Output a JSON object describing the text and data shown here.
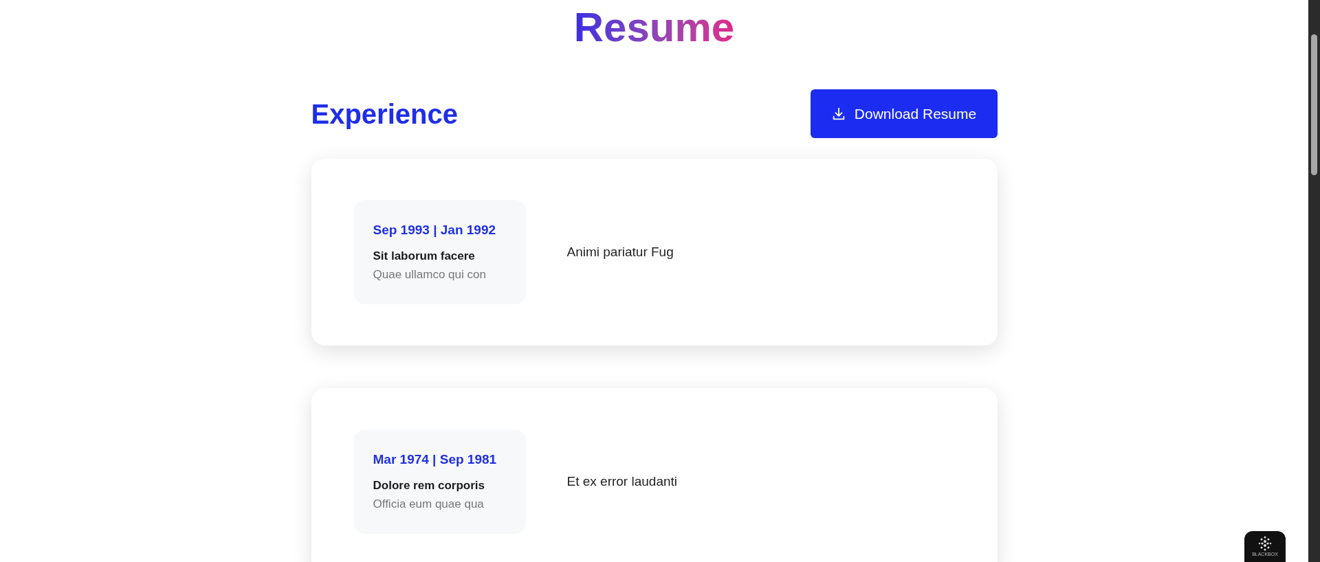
{
  "page_title": "Resume",
  "section": {
    "heading": "Experience",
    "download_button": "Download Resume"
  },
  "experiences": [
    {
      "dates": "Sep 1993 | Jan 1992",
      "title": "Sit laborum facere",
      "company": "Quae ullamco qui con",
      "description": "Animi pariatur Fug"
    },
    {
      "dates": "Mar 1974 | Sep 1981",
      "title": "Dolore rem corporis",
      "company": "Officia eum quae qua",
      "description": "Et ex error laudanti"
    }
  ],
  "widget": {
    "label": "BLACKBOX"
  }
}
